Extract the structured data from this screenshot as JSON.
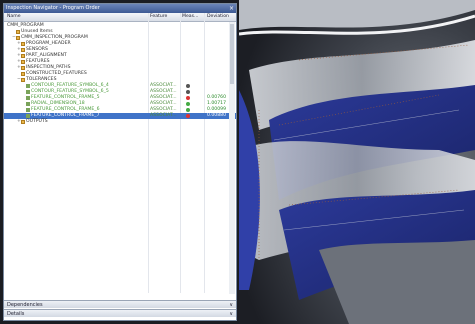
{
  "panel": {
    "title": "Inspection Navigator - Program Order",
    "close": "×",
    "columns": {
      "name": "Name",
      "feature": "Feature",
      "meas": "Meas...",
      "deviation": "Deviation"
    }
  },
  "tree": [
    {
      "label": "CMM_PROGRAM",
      "indent": 0,
      "icon": "none",
      "exp": ""
    },
    {
      "label": "Unused Items",
      "indent": 1,
      "icon": "folder",
      "exp": ""
    },
    {
      "label": "CMM_INSPECTION_PROGRAM",
      "indent": 1,
      "icon": "folder",
      "exp": "−"
    },
    {
      "label": "PROGRAM_HEADER",
      "indent": 2,
      "icon": "folder",
      "exp": "+"
    },
    {
      "label": "SENSORS",
      "indent": 2,
      "icon": "folder",
      "exp": "+"
    },
    {
      "label": "PART_ALIGNMENT",
      "indent": 2,
      "icon": "folder",
      "exp": "+"
    },
    {
      "label": "FEATURES",
      "indent": 2,
      "icon": "folder",
      "exp": "+"
    },
    {
      "label": "INSPECTION_PATHS",
      "indent": 2,
      "icon": "folder",
      "exp": "+"
    },
    {
      "label": "CONSTRUCTED_FEATURES",
      "indent": 2,
      "icon": "folder",
      "exp": ""
    },
    {
      "label": "TOLERANCES",
      "indent": 2,
      "icon": "folder",
      "exp": "−"
    },
    {
      "label": "CONTOUR_FEATURE_SYMBOL_6_4",
      "indent": 3,
      "icon": "tol",
      "exp": "",
      "feature": "ASSOCIAT...",
      "meas": "#555",
      "dev": "",
      "green": true
    },
    {
      "label": "CONTOUR_FEATURE_SYMBOL_6_5",
      "indent": 3,
      "icon": "tol",
      "exp": "",
      "feature": "ASSOCIAT...",
      "meas": "#555",
      "dev": "",
      "green": true
    },
    {
      "label": "FEATURE_CONTROL_FRAME_5",
      "indent": 3,
      "icon": "tol",
      "exp": "",
      "feature": "ASSOCIAT...",
      "meas": "#d33",
      "dev": "0.00760",
      "green": true
    },
    {
      "label": "RADIAL_DIMENSION_18",
      "indent": 3,
      "icon": "tol",
      "exp": "",
      "feature": "ASSOCIAT...",
      "meas": "#4a4",
      "dev": "1.00717",
      "green": true
    },
    {
      "label": "FEATURE_CONTROL_FRAME_6",
      "indent": 3,
      "icon": "tol",
      "exp": "",
      "feature": "ASSOCIAT...",
      "meas": "#4a4",
      "dev": "0.00099",
      "green": true
    },
    {
      "label": "FEATURE_CONTROL_FRAME_7",
      "indent": 3,
      "icon": "tol",
      "exp": "",
      "feature": "ASSOCIAT...",
      "meas": "#d33",
      "dev": "0.00880",
      "green": true,
      "selected": true
    },
    {
      "label": "OUTPUTS",
      "indent": 2,
      "icon": "folder",
      "exp": "+"
    }
  ],
  "bottom": {
    "dependencies": "Dependencies",
    "details": "Details",
    "chev": "∨"
  }
}
